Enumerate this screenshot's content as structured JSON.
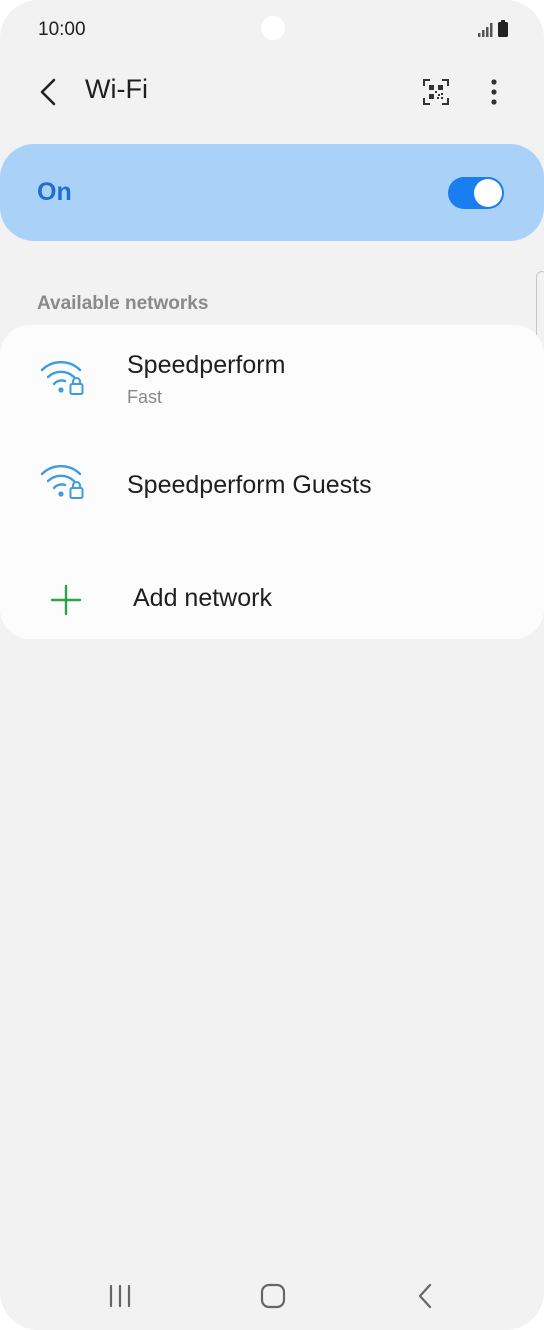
{
  "status_bar": {
    "time": "10:00",
    "icons": [
      "signal-icon",
      "battery-icon"
    ]
  },
  "header": {
    "title": "Wi-Fi",
    "icons": [
      "back-arrow-icon",
      "qr-code-icon",
      "more-vert-icon"
    ]
  },
  "wifi_toggle": {
    "label": "On",
    "state_on": true,
    "track_color": "#1a7df0",
    "card_color": "#aad2f8",
    "label_color": "#1d6fd0"
  },
  "available_networks": {
    "header": "Available networks",
    "networks": [
      {
        "name": "Speedperform",
        "status": "Fast",
        "icon": "wifi-lock-icon"
      },
      {
        "name": "Speedperform Guests",
        "icon": "wifi-lock-icon"
      }
    ],
    "add_network": {
      "label": "Add network",
      "icon": "plus-icon",
      "color": "#2ba24c"
    }
  },
  "nav_bar": {
    "icons": [
      "recents-icon",
      "home-icon",
      "back-icon"
    ]
  }
}
